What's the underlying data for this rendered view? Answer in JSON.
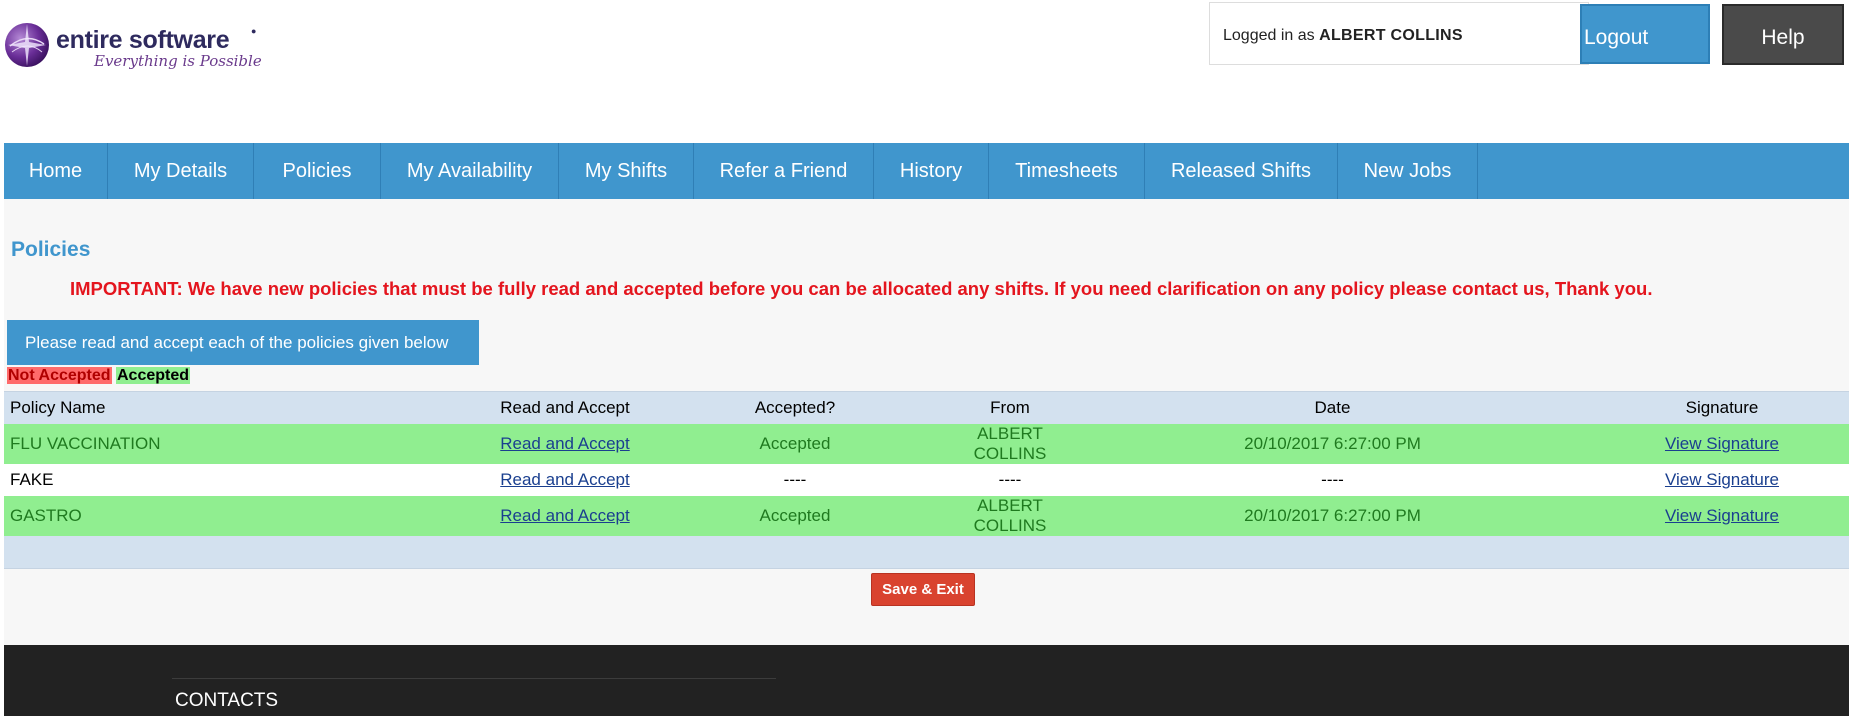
{
  "header": {
    "logo_name": "entire software",
    "logo_tagline": "Everything is Possible",
    "logged_in_prefix": "Logged in as",
    "logged_in_user": "ALBERT COLLINS",
    "logout_label": "Logout",
    "help_label": "Help"
  },
  "nav": {
    "items": [
      {
        "label": "Home"
      },
      {
        "label": "My Details"
      },
      {
        "label": "Policies"
      },
      {
        "label": "My Availability"
      },
      {
        "label": "My Shifts"
      },
      {
        "label": "Refer a Friend"
      },
      {
        "label": "History"
      },
      {
        "label": "Timesheets"
      },
      {
        "label": "Released Shifts"
      },
      {
        "label": "New Jobs"
      }
    ]
  },
  "main": {
    "title": "Policies",
    "important_notice": "IMPORTANT: We have new policies that must be fully read and accepted before you can be allocated any shifts. If you need clarification on any policy please contact us, Thank you.",
    "instruction": "Please read and accept each of the policies given below",
    "legend": {
      "not_accepted": "Not Accepted",
      "accepted": "Accepted"
    },
    "table": {
      "headers": [
        "Policy Name",
        "Read and Accept",
        "Accepted?",
        "From",
        "Date",
        "Signature"
      ],
      "rows": [
        {
          "name": "FLU VACCINATION",
          "read": "Read and Accept",
          "accepted": "Accepted",
          "from": "ALBERT COLLINS",
          "date": "20/10/2017 6:27:00 PM",
          "signature": "View Signature"
        },
        {
          "name": "FAKE",
          "read": "Read and Accept",
          "accepted": "----",
          "from": "----",
          "date": "----",
          "signature": "View Signature"
        },
        {
          "name": "GASTRO",
          "read": "Read and Accept",
          "accepted": "Accepted",
          "from": "ALBERT COLLINS",
          "date": "20/10/2017 6:27:00 PM",
          "signature": "View Signature"
        }
      ]
    },
    "save_label": "Save & Exit"
  },
  "footer": {
    "contacts_title": "CONTACTS"
  },
  "colors": {
    "primary": "#4096cd",
    "accepted_bg": "#90ee90",
    "not_accepted_bg": "#ff6b6b",
    "important_text": "#e4151e",
    "save_button": "#d9432f",
    "footer_bg": "#222222"
  }
}
